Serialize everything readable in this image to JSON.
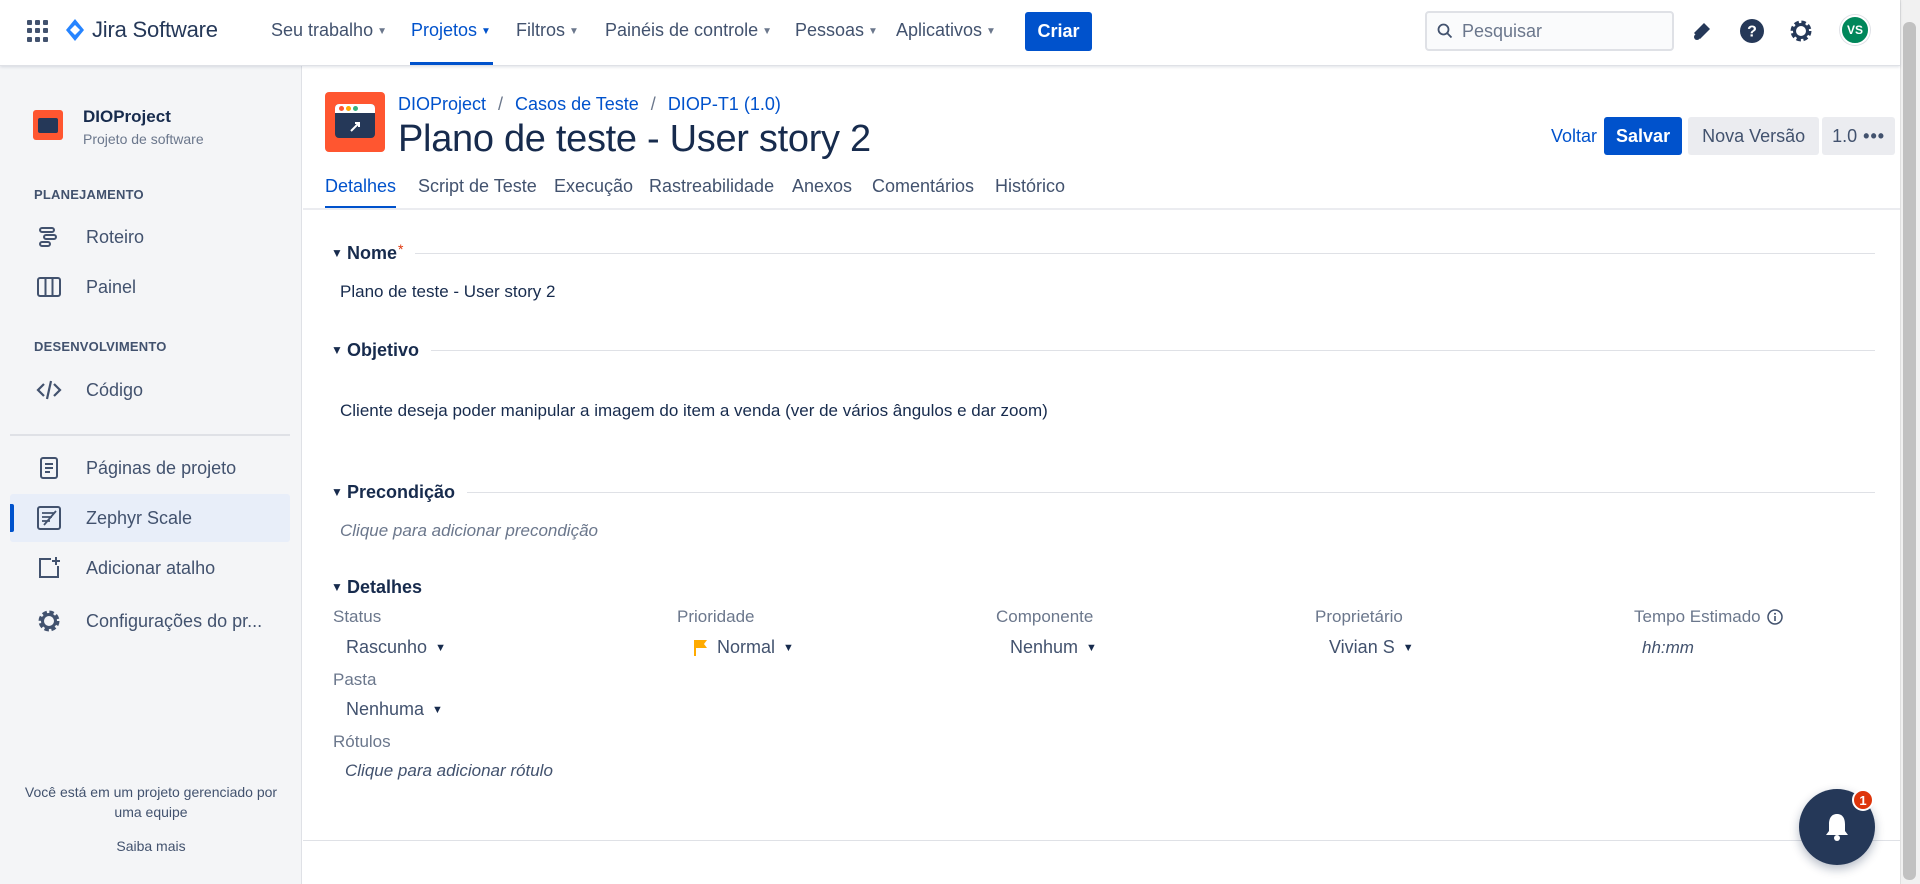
{
  "topnav": {
    "brand": "Jira Software",
    "items": [
      {
        "label": "Seu trabalho"
      },
      {
        "label": "Projetos"
      },
      {
        "label": "Filtros"
      },
      {
        "label": "Painéis de controle"
      },
      {
        "label": "Pessoas"
      },
      {
        "label": "Aplicativos"
      }
    ],
    "create_label": "Criar",
    "search_placeholder": "Pesquisar",
    "avatar_initials": "VS",
    "icons": [
      "apps-grid-icon",
      "notifications-icon",
      "help-icon",
      "settings-icon"
    ]
  },
  "sidebar": {
    "project_name": "DIOProject",
    "project_type": "Projeto de software",
    "planning_title": "PLANEJAMENTO",
    "planning_items": [
      {
        "label": "Roteiro",
        "icon": "roadmap-icon"
      },
      {
        "label": "Painel",
        "icon": "board-icon"
      }
    ],
    "dev_title": "DESENVOLVIMENTO",
    "dev_items": [
      {
        "label": "Código",
        "icon": "code-icon"
      }
    ],
    "extra_items": [
      {
        "label": "Páginas de projeto",
        "icon": "page-icon"
      },
      {
        "label": "Zephyr Scale",
        "icon": "zephyr-icon",
        "selected": true
      },
      {
        "label": "Adicionar atalho",
        "icon": "add-shortcut-icon"
      },
      {
        "label": "Configurações do pr...",
        "icon": "settings-icon"
      }
    ],
    "footer_text_1": "Você está em um projeto gerenciado por",
    "footer_text_2": "uma equipe",
    "footer_link": "Saiba mais"
  },
  "header": {
    "breadcrumbs": [
      "DIOProject",
      "Casos de Teste",
      "DIOP-T1 (1.0)"
    ],
    "title": "Plano de teste - User story 2",
    "back_label": "Voltar",
    "save_label": "Salvar",
    "new_version_label": "Nova Versão",
    "version": "1.0"
  },
  "tabs": [
    "Detalhes",
    "Script de Teste",
    "Execução",
    "Rastreabilidade",
    "Anexos",
    "Comentários",
    "Histórico"
  ],
  "form": {
    "nome": {
      "label": "Nome",
      "required_mark": "*",
      "value": "Plano de teste - User story 2"
    },
    "objetivo": {
      "label": "Objetivo",
      "value": "Cliente deseja poder manipular a imagem do item a venda (ver de vários ângulos e dar zoom)"
    },
    "precondicao": {
      "label": "Precondição",
      "placeholder": "Clique para adicionar precondição"
    },
    "detalhes": {
      "label": "Detalhes",
      "status_label": "Status",
      "status_value": "Rascunho",
      "prioridade_label": "Prioridade",
      "prioridade_value": "Normal",
      "componente_label": "Componente",
      "componente_value": "Nenhum",
      "proprietario_label": "Proprietário",
      "proprietario_value": "Vivian S",
      "tempo_label": "Tempo Estimado",
      "tempo_placeholder": "hh:mm",
      "pasta_label": "Pasta",
      "pasta_value": "Nenhuma",
      "rotulos_label": "Rótulos",
      "rotulos_placeholder": "Clique para adicionar rótulo"
    }
  },
  "fab": {
    "badge_count": "1"
  },
  "colors": {
    "accent": "#0052cc",
    "project_icon": "#ff5630",
    "priority_flag": "#ffab00"
  }
}
